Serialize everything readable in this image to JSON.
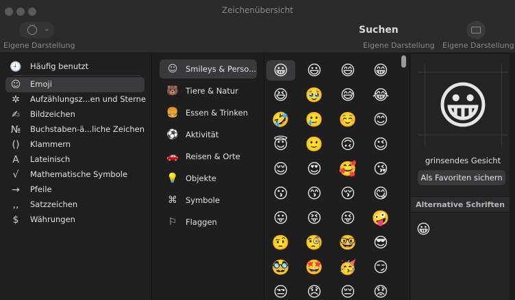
{
  "window": {
    "title": "Zeichenübersicht"
  },
  "toolbar": {
    "customize_label_left": "Eigene Darstellung",
    "search_title": "Suchen",
    "customize_label_search": "Eigene Darstellung",
    "customize_label_right": "Eigene Darstellung"
  },
  "categories": [
    {
      "icon": "clock-icon",
      "glyph": "🕘",
      "label": "Häufig benutzt"
    },
    {
      "icon": "smiley-icon",
      "glyph": "☺",
      "label": "Emoji",
      "selected": true
    },
    {
      "icon": "asterisk-icon",
      "glyph": "✲",
      "label": "Aufzählungsz...en und Sterne"
    },
    {
      "icon": "hand-icon",
      "glyph": "✍",
      "label": "Bildzeichen"
    },
    {
      "icon": "numero-icon",
      "glyph": "№",
      "label": "Buchstaben-ä...liche Zeichen"
    },
    {
      "icon": "parentheses-icon",
      "glyph": "()",
      "label": "Klammern"
    },
    {
      "icon": "letter-a-icon",
      "glyph": "A",
      "label": "Lateinisch"
    },
    {
      "icon": "root-icon",
      "glyph": "√",
      "label": "Mathematische Symbole"
    },
    {
      "icon": "arrow-icon",
      "glyph": "→",
      "label": "Pfeile"
    },
    {
      "icon": "punctuation-icon",
      "glyph": ",,",
      "label": "Satzzeichen"
    },
    {
      "icon": "dollar-icon",
      "glyph": "$",
      "label": "Währungen"
    }
  ],
  "subcategories": [
    {
      "icon": "smiley-icon",
      "glyph": "☺",
      "label": "Smileys & Perso...",
      "selected": true
    },
    {
      "icon": "bear-icon",
      "glyph": "🐻",
      "label": "Tiere & Natur"
    },
    {
      "icon": "food-icon",
      "glyph": "🍔",
      "label": "Essen & Trinken"
    },
    {
      "icon": "ball-icon",
      "glyph": "⚽",
      "label": "Aktivität"
    },
    {
      "icon": "car-icon",
      "glyph": "🚗",
      "label": "Reisen & Orte"
    },
    {
      "icon": "bulb-icon",
      "glyph": "💡",
      "label": "Objekte"
    },
    {
      "icon": "symbols-icon",
      "glyph": "⌘",
      "label": "Symbole"
    },
    {
      "icon": "flag-icon",
      "glyph": "⚐",
      "label": "Flaggen"
    }
  ],
  "emoji_grid": [
    [
      "😀",
      "😃",
      "😄",
      "😁"
    ],
    [
      "😆",
      "🥹",
      "😅",
      "😂"
    ],
    [
      "🤣",
      "🥲",
      "☺️",
      "😊"
    ],
    [
      "😇",
      "🙂",
      "🙃",
      "😉"
    ],
    [
      "😌",
      "😍",
      "🥰",
      "😘"
    ],
    [
      "😗",
      "😙",
      "😚",
      "😋"
    ],
    [
      "😛",
      "😝",
      "😜",
      "🤪"
    ],
    [
      "🤨",
      "🧐",
      "🤓",
      "😎"
    ],
    [
      "🥸",
      "🤩",
      "🥳",
      "😏"
    ],
    [
      "😒",
      "😞",
      "😔",
      "😟"
    ]
  ],
  "detail": {
    "preview_emoji": "😀",
    "name": "grinsendes Gesicht",
    "favorite_button": "Als Favoriten sichern",
    "alt_fonts_header": "Alternative Schriften",
    "alt_emoji": "😀"
  }
}
